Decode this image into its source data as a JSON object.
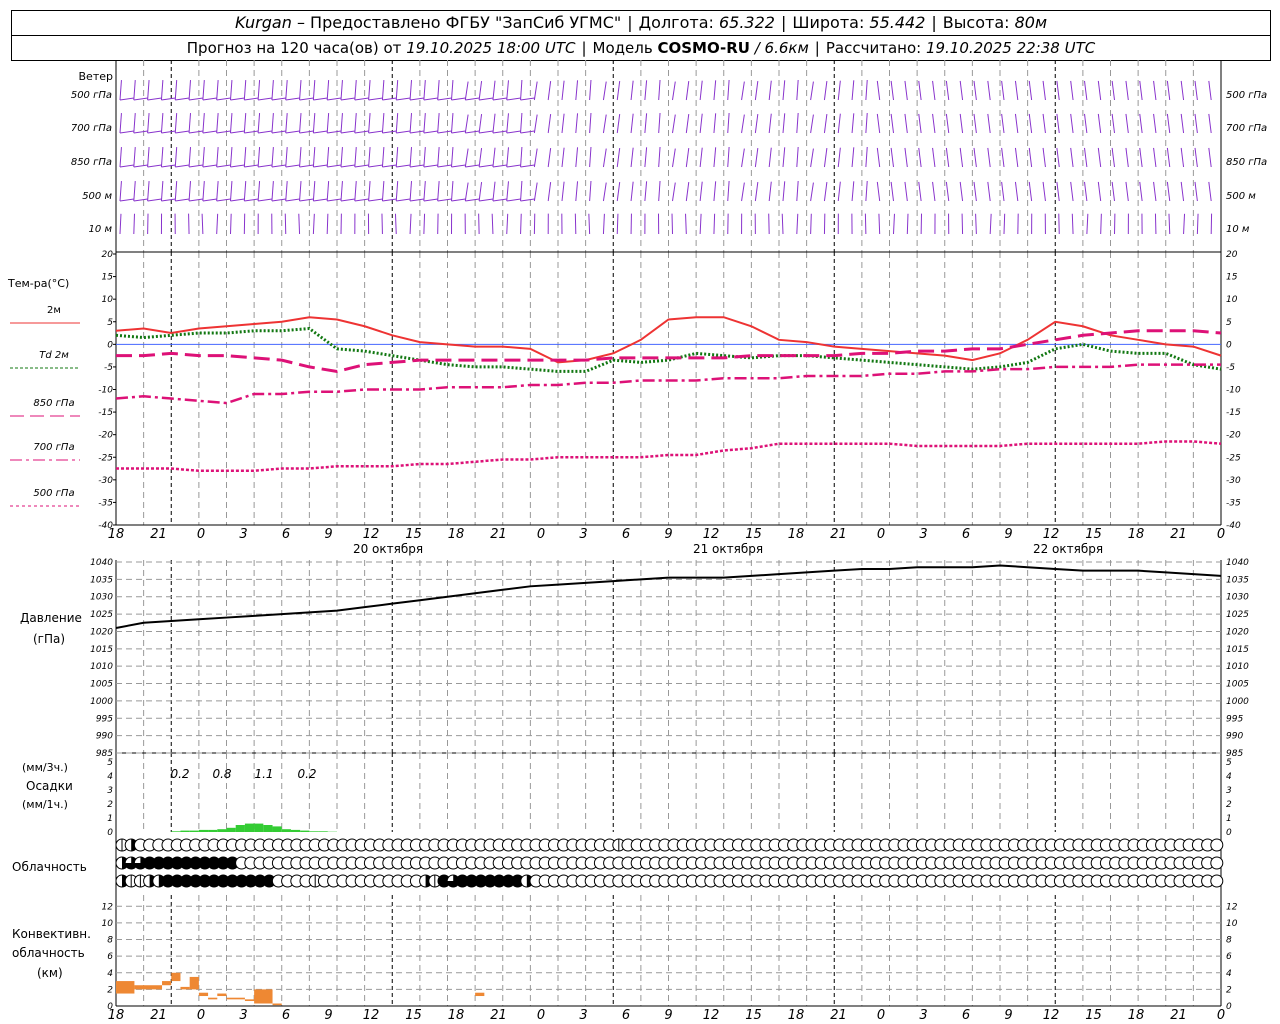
{
  "header": {
    "city": "Kurgan",
    "dash": "–",
    "provider": "Предоставлено ФГБУ \"ЗапСиб УГМС\"",
    "lon_label": "Долгота:",
    "lon": "65.322",
    "lat_label": "Широта:",
    "lat": "55.442",
    "alt_label": "Высота:",
    "alt": "80м",
    "forecast_label": "Прогноз на 120 часа(ов) от",
    "forecast_from": "19.10.2025 18:00 UTC",
    "model_label": "Модель",
    "model": "COSMO-RU",
    "model_res": "/ 6.6км",
    "calc_label": "Рассчитано:",
    "calc_time": "19.10.2025 22:38 UTC"
  },
  "labels": {
    "wind_title": "Ветер",
    "wind_levels": [
      "500 гПа",
      "700 гПа",
      "850 гПа",
      "500 м",
      "10  м"
    ],
    "temp_title": "Тем-ра(°С)",
    "temp_legend": [
      "2м",
      "Td  2м",
      "850 гПа",
      "700 гПа",
      "500 гПа"
    ],
    "pressure_title": "Давление",
    "pressure_unit": "(гПа)",
    "precip_labels": [
      "(мм/3ч.)",
      "Осадки",
      "(мм/1ч.)"
    ],
    "cloud_title": "Облачность",
    "conv_labels": [
      "Конвективн.",
      "облачность",
      "(км)"
    ]
  },
  "axis": {
    "hour_ticks": [
      "18",
      "21",
      "0",
      "3",
      "6",
      "9",
      "12",
      "15",
      "18",
      "21",
      "0",
      "3",
      "6",
      "9",
      "12",
      "15",
      "18",
      "21",
      "0",
      "3",
      "6",
      "9",
      "12",
      "15",
      "18",
      "21",
      "0"
    ],
    "dates": [
      "20 октября",
      "21 октября",
      "22 октября"
    ]
  },
  "chart_data": [
    {
      "type": "line",
      "title": "Тем-ра(°С)",
      "x_hours": [
        0,
        3,
        6,
        9,
        12,
        15,
        18,
        21,
        24,
        27,
        30,
        33,
        36,
        39,
        42,
        45,
        48,
        51,
        54,
        57,
        60,
        63,
        66,
        69,
        72,
        75,
        78,
        81,
        84,
        87,
        90,
        93,
        96,
        99,
        102,
        105,
        108,
        111,
        114,
        117,
        120
      ],
      "ylim": [
        -40,
        20
      ],
      "yticks": [
        20,
        15,
        10,
        5,
        0,
        -5,
        -10,
        -15,
        -20,
        -25,
        -30,
        -35,
        -40
      ],
      "series": [
        {
          "name": "2м",
          "color": "#ee3333",
          "values": [
            3,
            3.5,
            2.5,
            3.5,
            4,
            4.5,
            5,
            6,
            5.5,
            4,
            2,
            0.5,
            0,
            -0.5,
            -0.5,
            -1,
            -4,
            -3.5,
            -2,
            1,
            5.5,
            6,
            6,
            4,
            1,
            0.5,
            -0.5,
            -1,
            -1.5,
            -2,
            -2.5,
            -3.5,
            -2,
            1,
            5,
            4,
            2,
            1,
            0,
            -0.5,
            -2.5
          ]
        },
        {
          "name": "Td  2м",
          "color": "#117711",
          "values": [
            2,
            1.5,
            2,
            2.5,
            2.5,
            3,
            3,
            3.5,
            -1,
            -1.5,
            -2.5,
            -3.5,
            -4.5,
            -5,
            -5,
            -5.5,
            -6,
            -6,
            -3.5,
            -4,
            -3.5,
            -2,
            -2.5,
            -3,
            -2.5,
            -2.5,
            -3,
            -3.5,
            -4,
            -4.5,
            -5,
            -5.5,
            -5,
            -4,
            -1,
            0,
            -1.5,
            -2,
            -2,
            -4.5,
            -5.5
          ]
        },
        {
          "name": "850 гПа",
          "color": "#dd1177",
          "values": [
            -2.5,
            -2.5,
            -2,
            -2.5,
            -2.5,
            -3,
            -3.5,
            -5,
            -6,
            -4.5,
            -4,
            -3.5,
            -3.5,
            -3.5,
            -3.5,
            -3.5,
            -3.5,
            -3.5,
            -3,
            -3,
            -3,
            -3,
            -3,
            -2.5,
            -2.5,
            -2.5,
            -2.5,
            -2,
            -2,
            -1.5,
            -1.5,
            -1,
            -1,
            0,
            1,
            2,
            2.5,
            3,
            3,
            3,
            2.5
          ]
        },
        {
          "name": "700 гПа",
          "color": "#dd1177",
          "values": [
            -12,
            -11.5,
            -12,
            -12.5,
            -13,
            -11,
            -11,
            -10.5,
            -10.5,
            -10,
            -10,
            -10,
            -9.5,
            -9.5,
            -9.5,
            -9,
            -9,
            -8.5,
            -8.5,
            -8,
            -8,
            -8,
            -7.5,
            -7.5,
            -7.5,
            -7,
            -7,
            -7,
            -6.5,
            -6.5,
            -6,
            -6,
            -5.5,
            -5.5,
            -5,
            -5,
            -5,
            -4.5,
            -4.5,
            -4.5,
            -4.5
          ]
        },
        {
          "name": "500 гПа",
          "color": "#dd1177",
          "values": [
            -27.5,
            -27.5,
            -27.5,
            -28,
            -28,
            -28,
            -27.5,
            -27.5,
            -27,
            -27,
            -27,
            -26.5,
            -26.5,
            -26,
            -25.5,
            -25.5,
            -25,
            -25,
            -25,
            -25,
            -24.5,
            -24.5,
            -23.5,
            -23,
            -22,
            -22,
            -22,
            -22,
            -22,
            -22.5,
            -22.5,
            -22.5,
            -22.5,
            -22,
            -22,
            -22,
            -22,
            -22,
            -21.5,
            -21.5,
            -22
          ]
        }
      ]
    },
    {
      "type": "line",
      "title": "Давление",
      "ylim": [
        985,
        1040
      ],
      "yticks": [
        1040,
        1035,
        1030,
        1025,
        1020,
        1015,
        1010,
        1005,
        1000,
        995,
        990,
        985
      ],
      "series": [
        {
          "name": "Давление",
          "color": "#000000",
          "values": [
            1021,
            1022.5,
            1023,
            1023.5,
            1024,
            1024.5,
            1025,
            1025.5,
            1026,
            1027,
            1028,
            1029,
            1030,
            1031,
            1032,
            1033,
            1033.5,
            1034,
            1034.5,
            1035,
            1035.5,
            1035.5,
            1035.5,
            1036,
            1036.5,
            1037,
            1037.5,
            1038,
            1038,
            1038.5,
            1038.5,
            1038.5,
            1039,
            1038.5,
            1038,
            1037.5,
            1037.5,
            1037.5,
            1037,
            1036.5,
            1036
          ]
        }
      ]
    },
    {
      "type": "bar",
      "title": "Осадки",
      "ylim": [
        0,
        5
      ],
      "yticks": [
        5,
        4,
        3,
        2,
        1,
        0
      ],
      "hourly_values": [
        0,
        0,
        0,
        0,
        0,
        0,
        0.05,
        0.1,
        0.1,
        0.15,
        0.15,
        0.2,
        0.3,
        0.5,
        0.6,
        0.6,
        0.5,
        0.4,
        0.2,
        0.15,
        0.1,
        0.05,
        0.05,
        0.02
      ],
      "annotations": [
        "0.2",
        "0.8",
        "1.1",
        "0.2"
      ]
    },
    {
      "type": "bar",
      "title": "Конвективн. облачность",
      "ylim": [
        0,
        13
      ],
      "yticks": [
        12,
        10,
        8,
        6,
        4,
        2,
        0
      ],
      "bars": [
        {
          "h0": 0,
          "h1": 2,
          "base": 1.5,
          "top": 3
        },
        {
          "h0": 2,
          "h1": 5,
          "base": 2,
          "top": 2.5
        },
        {
          "h0": 5,
          "h1": 6,
          "base": 2.5,
          "top": 3
        },
        {
          "h0": 6,
          "h1": 7,
          "base": 3,
          "top": 4
        },
        {
          "h0": 7,
          "h1": 8,
          "base": 2,
          "top": 2.3
        },
        {
          "h0": 8,
          "h1": 9,
          "base": 2,
          "top": 3.5
        },
        {
          "h0": 9,
          "h1": 10,
          "base": 1.2,
          "top": 1.6
        },
        {
          "h0": 10,
          "h1": 11,
          "base": 0.8,
          "top": 1
        },
        {
          "h0": 11,
          "h1": 12,
          "base": 1.2,
          "top": 1.5
        },
        {
          "h0": 12,
          "h1": 14,
          "base": 0.8,
          "top": 1
        },
        {
          "h0": 14,
          "h1": 15,
          "base": 0.6,
          "top": 0.8
        },
        {
          "h0": 15,
          "h1": 17,
          "base": 0.3,
          "top": 2
        },
        {
          "h0": 17,
          "h1": 18,
          "base": 0.1,
          "top": 0.3
        },
        {
          "h0": 39,
          "h1": 40,
          "base": 1.2,
          "top": 1.6
        }
      ]
    }
  ],
  "clouds": {
    "rows": [
      {
        "name": "high",
        "values": [
          1,
          2,
          0,
          0,
          0,
          0,
          0,
          0,
          0,
          0,
          0,
          0,
          0,
          0,
          0,
          0,
          0,
          0,
          0,
          0,
          0,
          0,
          0,
          0,
          0,
          0,
          0,
          0,
          0,
          0,
          0,
          0,
          0,
          0,
          0,
          0,
          0,
          0,
          0,
          0,
          0,
          0,
          0,
          0,
          0,
          0,
          0,
          0,
          0,
          0,
          0,
          0,
          0,
          0,
          1,
          0,
          0,
          0,
          0,
          0,
          0,
          0,
          0,
          0,
          0,
          0,
          0,
          0,
          0,
          0,
          0,
          0,
          0,
          0,
          0,
          0,
          0,
          0,
          0,
          0,
          0,
          0,
          0,
          0,
          0,
          0,
          0,
          0,
          0,
          0,
          0,
          0,
          0,
          0,
          0,
          0,
          0,
          0,
          0,
          0,
          0,
          0,
          0,
          0,
          0,
          0,
          0,
          0,
          0,
          0,
          0,
          0,
          0,
          0,
          0,
          0,
          0,
          0,
          0,
          0,
          3
        ]
      },
      {
        "name": "middle",
        "values": [
          2,
          3,
          3,
          4,
          4,
          4,
          4,
          4,
          4,
          4,
          4,
          4,
          4,
          0,
          0,
          0,
          0,
          0,
          0,
          0,
          0,
          0,
          0,
          0,
          0,
          0,
          0,
          0,
          0,
          0,
          0,
          0,
          0,
          0,
          0,
          0,
          0,
          0,
          0,
          0,
          0,
          0,
          0,
          0,
          0,
          0,
          0,
          0,
          0,
          0,
          0,
          0,
          0,
          0,
          0,
          0,
          0,
          0,
          0,
          0,
          0,
          0,
          0,
          0,
          0,
          0,
          0,
          0,
          0,
          0,
          0,
          0,
          0,
          0,
          0,
          0,
          0,
          0,
          0,
          0,
          0,
          0,
          0,
          0,
          0,
          0,
          0,
          0,
          0,
          0,
          0,
          0,
          0,
          0,
          0,
          0,
          0,
          0,
          0,
          0,
          0,
          0,
          0,
          0,
          0,
          0,
          0,
          0,
          0,
          0,
          0,
          0,
          0,
          0,
          0,
          0,
          0,
          0,
          0,
          0,
          0
        ]
      },
      {
        "name": "low",
        "values": [
          2,
          1,
          1,
          2,
          2,
          4,
          4,
          4,
          4,
          4,
          4,
          4,
          4,
          4,
          4,
          4,
          4,
          0,
          0,
          0,
          0,
          1,
          0,
          0,
          0,
          0,
          0,
          0,
          0,
          0,
          0,
          0,
          0,
          2,
          1,
          4,
          3,
          4,
          4,
          4,
          4,
          4,
          4,
          4,
          2,
          0,
          0,
          0,
          0,
          0,
          0,
          0,
          0,
          0,
          0,
          0,
          0,
          0,
          0,
          0,
          0,
          0,
          0,
          0,
          0,
          0,
          0,
          0,
          0,
          0,
          0,
          0,
          0,
          0,
          0,
          0,
          0,
          0,
          0,
          0,
          0,
          0,
          0,
          0,
          0,
          0,
          0,
          0,
          0,
          0,
          0,
          0,
          0,
          0,
          0,
          0,
          0,
          0,
          0,
          0,
          0,
          0,
          0,
          0,
          0,
          0,
          0,
          0,
          0,
          0,
          0,
          0,
          0,
          0,
          0,
          0,
          0,
          0,
          0,
          0,
          0
        ]
      }
    ]
  }
}
